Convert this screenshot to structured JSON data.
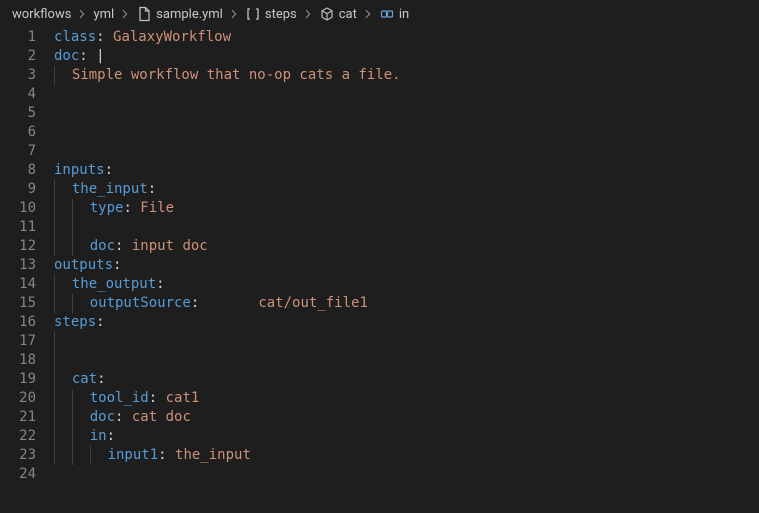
{
  "breadcrumb": {
    "workflows": "workflows",
    "yml": "yml",
    "file": "sample.yml",
    "steps": "steps",
    "cat": "cat",
    "in": "in"
  },
  "gutter": {
    "l1": "1",
    "l2": "2",
    "l3": "3",
    "l4": "4",
    "l5": "5",
    "l6": "6",
    "l7": "7",
    "l8": "8",
    "l9": "9",
    "l10": "10",
    "l11": "11",
    "l12": "12",
    "l13": "13",
    "l14": "14",
    "l15": "15",
    "l16": "16",
    "l17": "17",
    "l18": "18",
    "l19": "19",
    "l20": "20",
    "l21": "21",
    "l22": "22",
    "l23": "23",
    "l24": "24"
  },
  "code": {
    "class_key": "class",
    "class_val": "GalaxyWorkflow",
    "doc_key": "doc",
    "doc_pipe": "|",
    "doc_text": "Simple workflow that no-op cats a file.",
    "inputs_key": "inputs",
    "the_input_key": "the_input",
    "type_key": "type",
    "type_val": "File",
    "idoc_key": "doc",
    "idoc_val": "input doc",
    "outputs_key": "outputs",
    "the_output_key": "the_output",
    "osrc_key": "outputSource",
    "osrc_val": "cat/out_file1",
    "steps_key": "steps",
    "cat_key": "cat",
    "tool_id_key": "tool_id",
    "tool_id_val": "cat1",
    "sdoc_key": "doc",
    "sdoc_val": "cat doc",
    "in_key": "in",
    "input1_key": "input1",
    "input1_val": "the_input"
  }
}
